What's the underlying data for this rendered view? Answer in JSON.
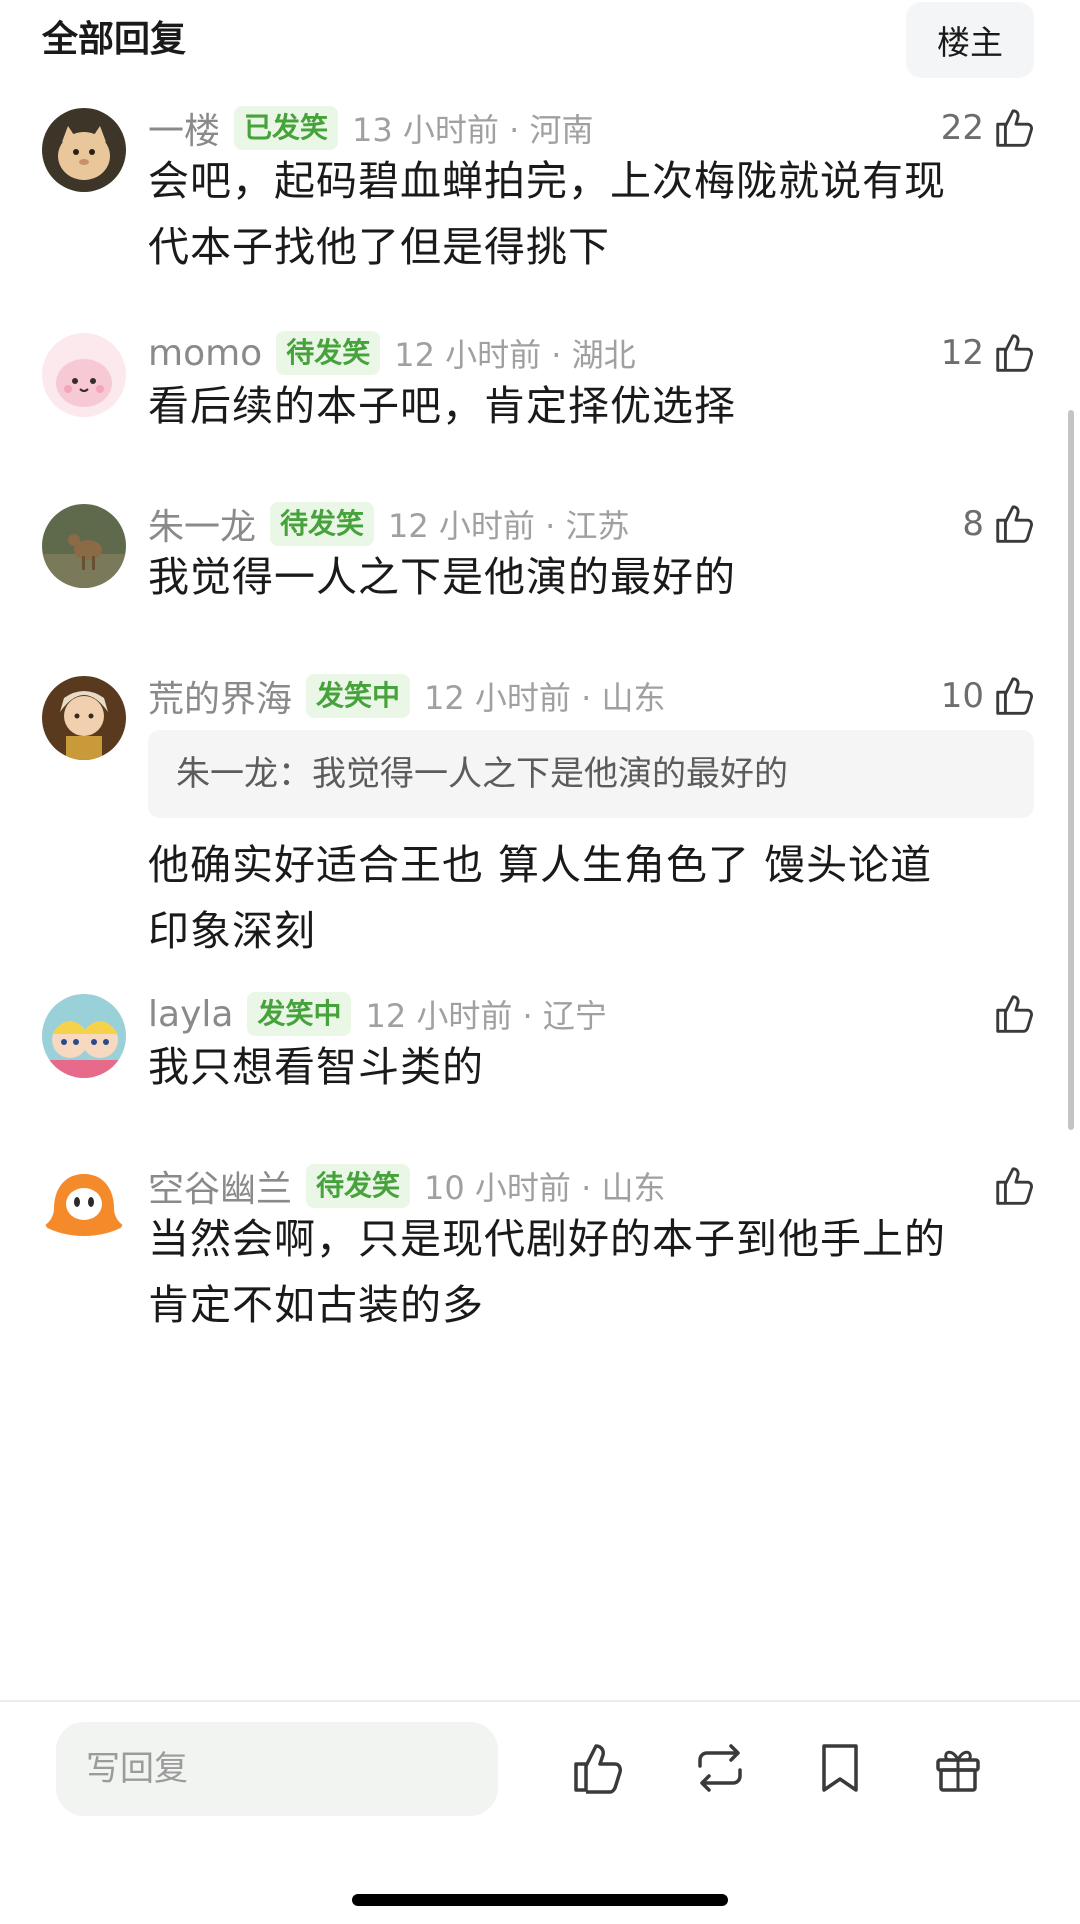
{
  "header": {
    "title": "全部回复",
    "owner_filter": "楼主"
  },
  "comments": [
    {
      "user": "一楼",
      "badge": "已发笑",
      "time": "13 小时前 · 河南",
      "likes": "22",
      "lines": [
        "会吧，起码碧血蝉拍完，上次梅陇就说有现",
        "代本子找他了但是得挑下"
      ]
    },
    {
      "user": "momo",
      "badge": "待发笑",
      "time": "12 小时前 · 湖北",
      "likes": "12",
      "lines": [
        "看后续的本子吧，肯定择优选择"
      ]
    },
    {
      "user": "朱一龙",
      "badge": "待发笑",
      "time": "12 小时前 · 江苏",
      "likes": "8",
      "lines": [
        "我觉得一人之下是他演的最好的"
      ]
    },
    {
      "user": "荒的界海",
      "badge": "发笑中",
      "time": "12 小时前 · 山东",
      "likes": "10",
      "quote": "朱一龙：我觉得一人之下是他演的最好的",
      "lines": [
        "他确实好适合王也 算人生角色了 馒头论道",
        "印象深刻"
      ]
    },
    {
      "user": "layla",
      "badge": "发笑中",
      "time": "12 小时前 · 辽宁",
      "likes": "",
      "lines": [
        "我只想看智斗类的"
      ]
    },
    {
      "user": "空谷幽兰",
      "badge": "待发笑",
      "time": "10 小时前 · 山东",
      "likes": "",
      "lines": [
        "当然会啊，只是现代剧好的本子到他手上的",
        "肯定不如古装的多"
      ]
    }
  ],
  "bottom_bar": {
    "reply_placeholder": "写回复",
    "icons": [
      "like-icon",
      "repost-icon",
      "bookmark-icon",
      "gift-icon"
    ]
  },
  "colors": {
    "badge_text": "#46a23a",
    "badge_bg": "#eaf6e6",
    "meta_gray": "#a0a0a0"
  }
}
